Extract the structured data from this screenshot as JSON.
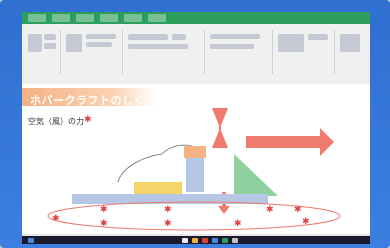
{
  "slide": {
    "title": "ホバークラフトのしくみ",
    "subtitle": "空気（風）の力",
    "subtitle_marker": "✱"
  },
  "diagram": {
    "labels": []
  },
  "colors": {
    "ribbon_accent": "#2e9e5c",
    "title_band": "#f4b183",
    "arrow": "#ef7a6e",
    "deck": "#b6c7e6",
    "yellow_block": "#f4d56a",
    "green_sail": "#8fd19e",
    "star": "#e04040"
  },
  "icons": [
    "fan-icon",
    "thrust-arrow-icon",
    "down-arrow-icon"
  ]
}
